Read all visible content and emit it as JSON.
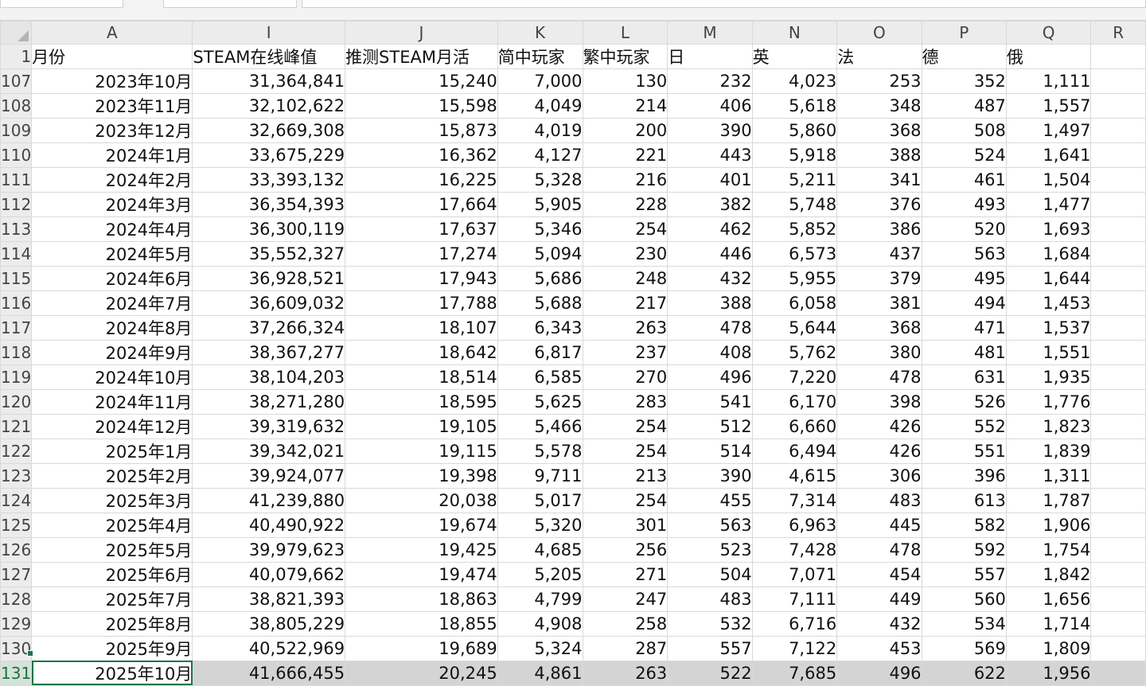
{
  "columns": [
    "A",
    "I",
    "J",
    "K",
    "L",
    "M",
    "N",
    "O",
    "P",
    "Q",
    "R"
  ],
  "header_row": {
    "row_number": "1",
    "cells": [
      "月份",
      "STEAM在线峰值",
      "推测STEAM月活",
      "简中玩家",
      "繁中玩家",
      "日",
      "英",
      "法",
      "德",
      "俄"
    ]
  },
  "rows": [
    {
      "n": "107",
      "cells": [
        "2023年10月",
        "31,364,841",
        "15,240",
        "7,000",
        "130",
        "232",
        "4,023",
        "253",
        "352",
        "1,111"
      ]
    },
    {
      "n": "108",
      "cells": [
        "2023年11月",
        "32,102,622",
        "15,598",
        "4,049",
        "214",
        "406",
        "5,618",
        "348",
        "487",
        "1,557"
      ]
    },
    {
      "n": "109",
      "cells": [
        "2023年12月",
        "32,669,308",
        "15,873",
        "4,019",
        "200",
        "390",
        "5,860",
        "368",
        "508",
        "1,497"
      ]
    },
    {
      "n": "110",
      "cells": [
        "2024年1月",
        "33,675,229",
        "16,362",
        "4,127",
        "221",
        "443",
        "5,918",
        "388",
        "524",
        "1,641"
      ]
    },
    {
      "n": "111",
      "cells": [
        "2024年2月",
        "33,393,132",
        "16,225",
        "5,328",
        "216",
        "401",
        "5,211",
        "341",
        "461",
        "1,504"
      ]
    },
    {
      "n": "112",
      "cells": [
        "2024年3月",
        "36,354,393",
        "17,664",
        "5,905",
        "228",
        "382",
        "5,748",
        "376",
        "493",
        "1,477"
      ]
    },
    {
      "n": "113",
      "cells": [
        "2024年4月",
        "36,300,119",
        "17,637",
        "5,346",
        "254",
        "462",
        "5,852",
        "386",
        "520",
        "1,693"
      ]
    },
    {
      "n": "114",
      "cells": [
        "2024年5月",
        "35,552,327",
        "17,274",
        "5,094",
        "230",
        "446",
        "6,573",
        "437",
        "563",
        "1,684"
      ]
    },
    {
      "n": "115",
      "cells": [
        "2024年6月",
        "36,928,521",
        "17,943",
        "5,686",
        "248",
        "432",
        "5,955",
        "379",
        "495",
        "1,644"
      ]
    },
    {
      "n": "116",
      "cells": [
        "2024年7月",
        "36,609,032",
        "17,788",
        "5,688",
        "217",
        "388",
        "6,058",
        "381",
        "494",
        "1,453"
      ]
    },
    {
      "n": "117",
      "cells": [
        "2024年8月",
        "37,266,324",
        "18,107",
        "6,343",
        "263",
        "478",
        "5,644",
        "368",
        "471",
        "1,537"
      ]
    },
    {
      "n": "118",
      "cells": [
        "2024年9月",
        "38,367,277",
        "18,642",
        "6,817",
        "237",
        "408",
        "5,762",
        "380",
        "481",
        "1,551"
      ]
    },
    {
      "n": "119",
      "cells": [
        "2024年10月",
        "38,104,203",
        "18,514",
        "6,585",
        "270",
        "496",
        "7,220",
        "478",
        "631",
        "1,935"
      ]
    },
    {
      "n": "120",
      "cells": [
        "2024年11月",
        "38,271,280",
        "18,595",
        "5,625",
        "283",
        "541",
        "6,170",
        "398",
        "526",
        "1,776"
      ]
    },
    {
      "n": "121",
      "cells": [
        "2024年12月",
        "39,319,632",
        "19,105",
        "5,466",
        "254",
        "512",
        "6,660",
        "426",
        "552",
        "1,823"
      ]
    },
    {
      "n": "122",
      "cells": [
        "2025年1月",
        "39,342,021",
        "19,115",
        "5,578",
        "254",
        "514",
        "6,494",
        "426",
        "551",
        "1,839"
      ]
    },
    {
      "n": "123",
      "cells": [
        "2025年2月",
        "39,924,077",
        "19,398",
        "9,711",
        "213",
        "390",
        "4,615",
        "306",
        "396",
        "1,311"
      ]
    },
    {
      "n": "124",
      "cells": [
        "2025年3月",
        "41,239,880",
        "20,038",
        "5,017",
        "254",
        "455",
        "7,314",
        "483",
        "613",
        "1,787"
      ]
    },
    {
      "n": "125",
      "cells": [
        "2025年4月",
        "40,490,922",
        "19,674",
        "5,320",
        "301",
        "563",
        "6,963",
        "445",
        "582",
        "1,906"
      ]
    },
    {
      "n": "126",
      "cells": [
        "2025年5月",
        "39,979,623",
        "19,425",
        "4,685",
        "256",
        "523",
        "7,428",
        "478",
        "592",
        "1,754"
      ]
    },
    {
      "n": "127",
      "cells": [
        "2025年6月",
        "40,079,662",
        "19,474",
        "5,205",
        "271",
        "504",
        "7,071",
        "454",
        "557",
        "1,842"
      ]
    },
    {
      "n": "128",
      "cells": [
        "2025年7月",
        "38,821,393",
        "18,863",
        "4,799",
        "247",
        "483",
        "7,111",
        "449",
        "560",
        "1,656"
      ]
    },
    {
      "n": "129",
      "cells": [
        "2025年8月",
        "38,805,229",
        "18,855",
        "4,908",
        "258",
        "532",
        "6,716",
        "432",
        "534",
        "1,714"
      ]
    },
    {
      "n": "130",
      "cells": [
        "2025年9月",
        "40,522,969",
        "19,689",
        "5,324",
        "287",
        "557",
        "7,122",
        "453",
        "569",
        "1,809"
      ]
    },
    {
      "n": "131",
      "cells": [
        "2025年10月",
        "41,666,455",
        "20,245",
        "4,861",
        "263",
        "522",
        "7,685",
        "496",
        "622",
        "1,956"
      ]
    }
  ],
  "active_row": "131",
  "colors": {
    "selection_border": "#217346",
    "active_row_fill": "#d4d4d4",
    "header_bg": "#ececec"
  }
}
